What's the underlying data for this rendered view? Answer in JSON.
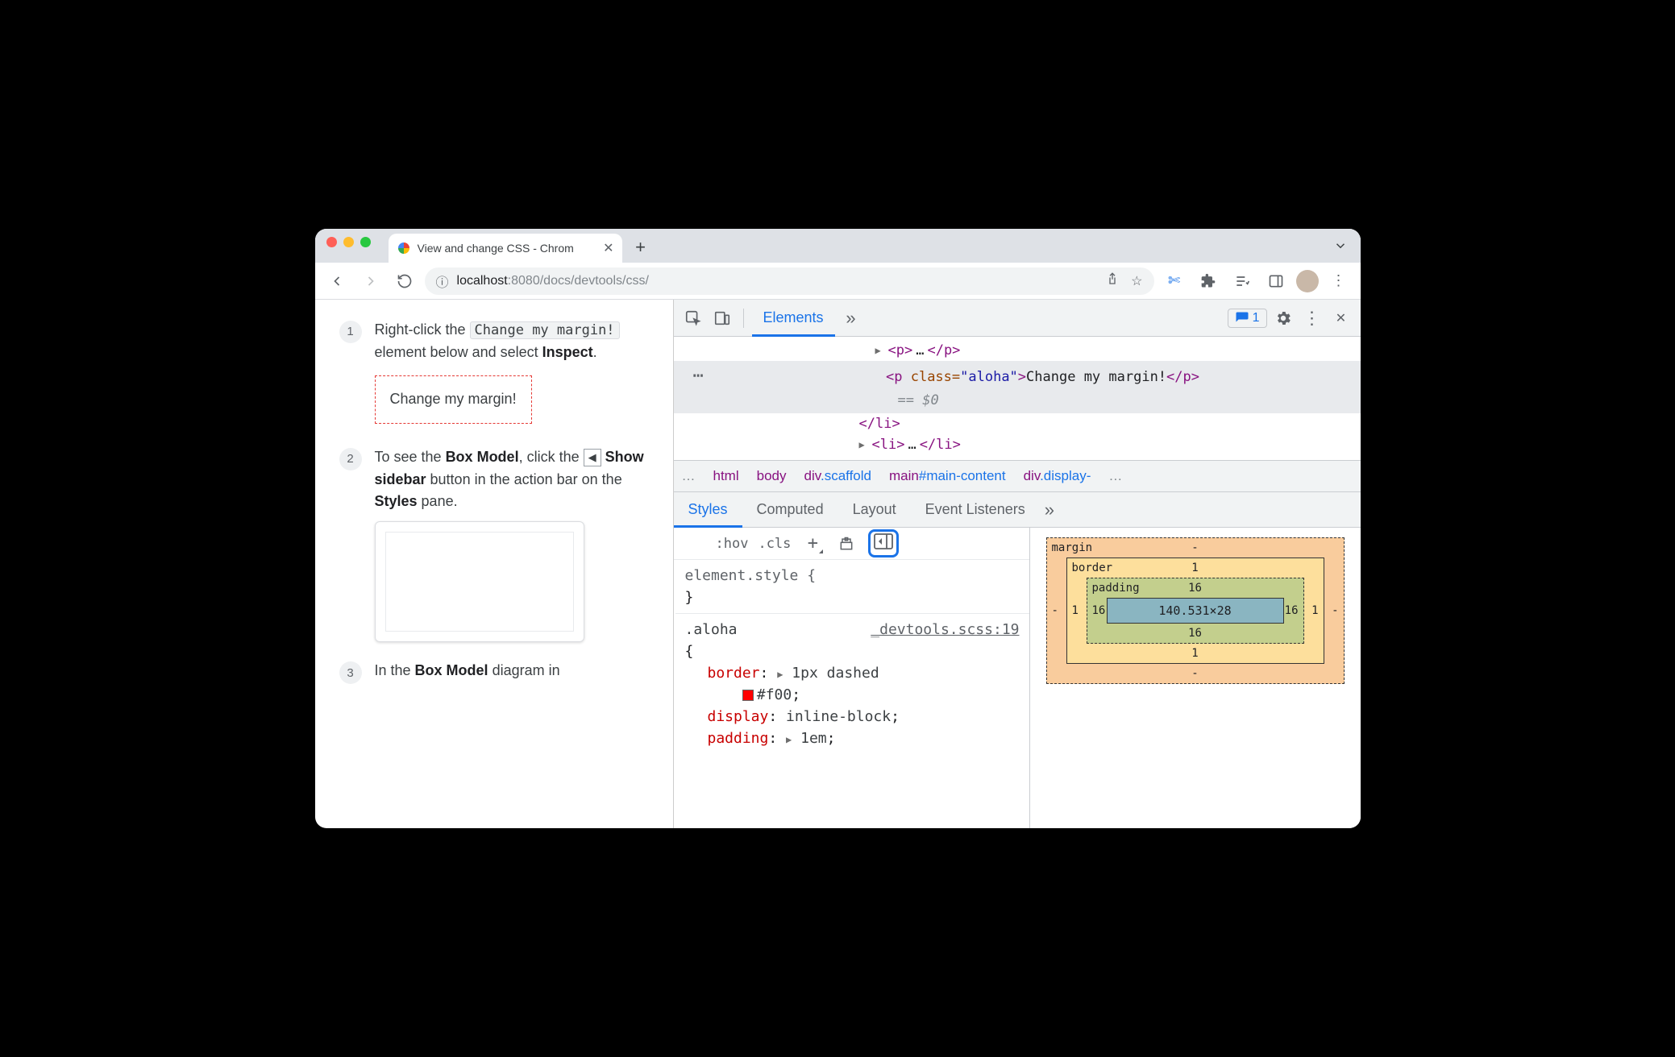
{
  "browser": {
    "tab_title": "View and change CSS - Chrom",
    "url_host_prefix": "localhost",
    "url_host_port": ":8080",
    "url_path": "/docs/devtools/css/"
  },
  "page": {
    "step1": {
      "num": "1",
      "pre": "Right-click the ",
      "code": "Change my margin!",
      "mid": " element below and select ",
      "bold": "Inspect",
      "suffix": ".",
      "demo": "Change my margin!"
    },
    "step2": {
      "num": "2",
      "t1": "To see the ",
      "b1": "Box Model",
      "t2": ", click the ",
      "icon_glyph": "◀",
      "b2": "Show sidebar",
      "t3": " button in the action bar on the ",
      "b3": "Styles",
      "t4": " pane."
    },
    "step3": {
      "num": "3",
      "t1": "In the ",
      "b1": "Box Model",
      "t2": " diagram in"
    }
  },
  "devtools": {
    "main_tabs": {
      "elements": "Elements"
    },
    "issues_count": "1",
    "dom": {
      "row1": "<p>…</p>",
      "sel_open": "<p ",
      "sel_attr": "class=",
      "sel_val": "\"aloha\"",
      "sel_close": ">",
      "sel_text": "Change my margin!",
      "sel_end": "</p>",
      "eqsel": "== $0",
      "close_li": "</li>",
      "next_li": "<li>…</li>"
    },
    "crumbs": {
      "c1": "html",
      "c2": "body",
      "c3": "div",
      "c3s": ".scaffold",
      "c4": "main",
      "c4s": "#main-content",
      "c5": "div",
      "c5s": ".display-"
    },
    "sp_tabs": {
      "styles": "Styles",
      "computed": "Computed",
      "layout": "Layout",
      "listeners": "Event Listeners"
    },
    "actionbar": {
      "hov": ":hov",
      "cls": ".cls"
    },
    "rules": {
      "r1_sel": "element.style {",
      "r1_close": "}",
      "r2_sel": ".aloha",
      "r2_src": "_devtools.scss:19",
      "r2_open": "{",
      "p1_name": "border",
      "p1_pre": "1px dashed",
      "p1_hex": "#f00",
      "p2_name": "display",
      "p2_val": "inline-block",
      "p3_name": "padding",
      "p3_val": "1em"
    },
    "box": {
      "margin_label": "margin",
      "margin_t": "-",
      "margin_r": "-",
      "margin_b": "-",
      "margin_l": "-",
      "border_label": "border",
      "border_t": "1",
      "border_r": "1",
      "border_b": "1",
      "border_l": "1",
      "padding_label": "padding",
      "padding_t": "16",
      "padding_r": "16",
      "padding_b": "16",
      "padding_l": "16",
      "content": "140.531×28"
    }
  }
}
